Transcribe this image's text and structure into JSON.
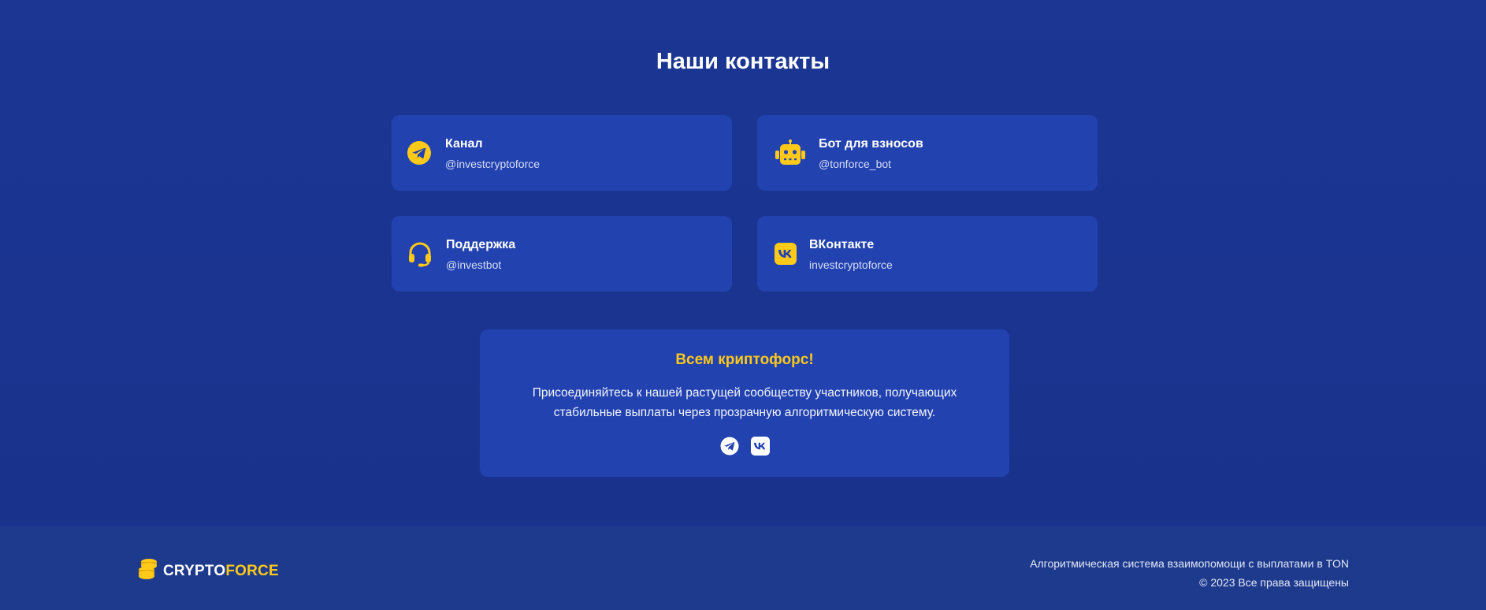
{
  "section": {
    "title": "Наши контакты"
  },
  "contacts": [
    {
      "icon": "telegram-icon",
      "title": "Канал",
      "handle": "@investcryptoforce"
    },
    {
      "icon": "robot-icon",
      "title": "Бот для взносов",
      "handle": "@tonforce_bot"
    },
    {
      "icon": "headset-icon",
      "title": "Поддержка",
      "handle": "@investbot"
    },
    {
      "icon": "vk-icon",
      "title": "ВКонтакте",
      "handle": "investcryptoforce"
    }
  ],
  "cta": {
    "title": "Всем криптофорс!",
    "text": "Присоединяйтесь к нашей растущей сообществу участников, получающих стабильные выплаты через прозрачную алгоритмическую систему.",
    "socials": [
      "telegram-icon",
      "vk-icon"
    ]
  },
  "footer": {
    "logo_part1": "CRYPTO",
    "logo_part2": "FORCE",
    "tagline": "Алгоритмическая система взаимопомощи с выплатами в TON",
    "copyright": "© 2023 Все права защищены"
  },
  "colors": {
    "accent": "#ffc919",
    "card": "#2242b0",
    "background": "#1b3590"
  }
}
